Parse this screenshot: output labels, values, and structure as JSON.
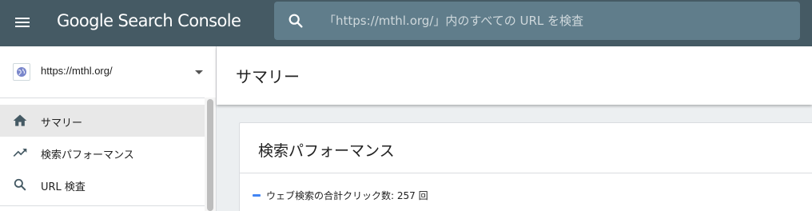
{
  "app": {
    "title": "Google Search Console"
  },
  "search": {
    "placeholder": "「https://mthl.org/」内のすべての URL を検査"
  },
  "property": {
    "url": "https://mthl.org/"
  },
  "sidebar": {
    "items": [
      {
        "label": "サマリー",
        "icon": "home-icon",
        "active": true
      },
      {
        "label": "検索パフォーマンス",
        "icon": "trending-up-icon",
        "active": false
      },
      {
        "label": "URL 検査",
        "icon": "search-icon",
        "active": false
      }
    ]
  },
  "page": {
    "title": "サマリー"
  },
  "performance_card": {
    "title": "検索パフォーマンス",
    "legend": "ウェブ検索の合計クリック数: 257 回",
    "legend_color": "#4285f4"
  },
  "colors": {
    "topbar": "#455a64",
    "searchbox": "#607d8b",
    "active_nav": "#e8e8e8"
  }
}
